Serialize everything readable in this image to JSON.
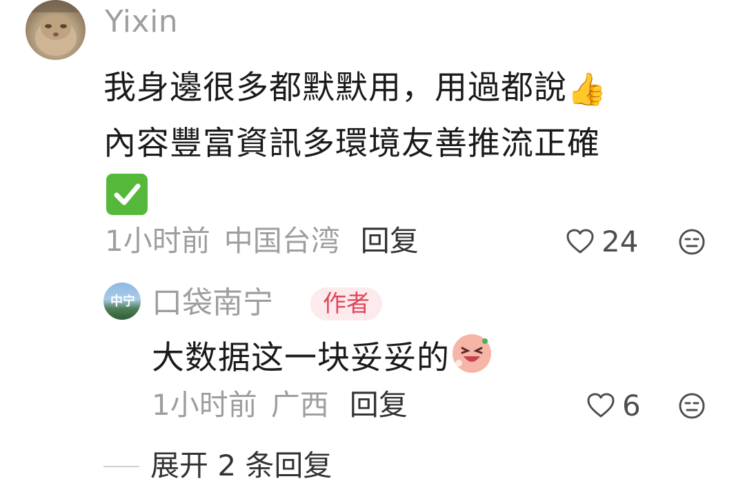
{
  "comment": {
    "username": "Yixin",
    "text_line1": "我身邊很多都默默用，用過都說",
    "text_line2": "內容豐富資訊多環境友善推流正確",
    "time": "1小时前",
    "location": "中国台湾",
    "reply_label": "回复",
    "likes": "24",
    "emojis": [
      "thumbs-up",
      "check-mark"
    ]
  },
  "reply": {
    "avatar_text": "中宁",
    "username": "口袋南宁",
    "badge": "作者",
    "text": "大数据这一块妥妥的",
    "time": "1小时前",
    "location": "广西",
    "reply_label": "回复",
    "likes": "6",
    "emoji": "laughing-face"
  },
  "expand": {
    "label": "展开 2 条回复"
  },
  "colors": {
    "meta_gray": "#9e9e9e",
    "text": "#1a1a1a",
    "badge_bg": "#fdeaec",
    "badge_fg": "#e0465b",
    "check_green": "#56b83a"
  }
}
